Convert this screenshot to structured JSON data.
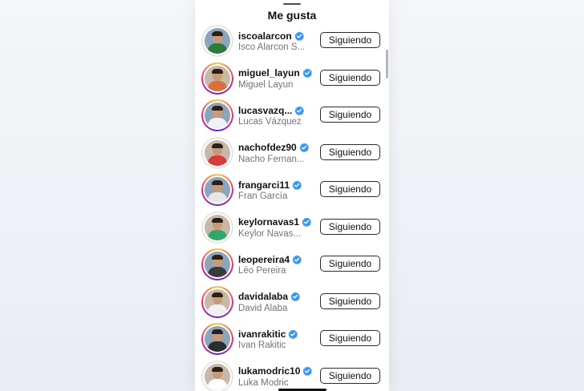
{
  "sheet": {
    "title": "Me gusta"
  },
  "colors": {
    "verified": "#3897f0",
    "story_ring": "#ee2a7b",
    "button_border": "#2a2a2a",
    "secondary_text": "#737373"
  },
  "users": [
    {
      "username": "iscoalarcon",
      "full_name": "Isco Alarcon S...",
      "button": "Siguiendo",
      "ring": false,
      "jersey": "#2f7a3a"
    },
    {
      "username": "miguel_layun",
      "full_name": "Miguel Layun",
      "button": "Siguiendo",
      "ring": true,
      "jersey": "#d9703a"
    },
    {
      "username": "lucasvazq...",
      "full_name": "Lucas Vázquez",
      "button": "Siguiendo",
      "ring": true,
      "jersey": "#f2f2f2"
    },
    {
      "username": "nachofdez90",
      "full_name": "Nacho Fernan...",
      "button": "Siguiendo",
      "ring": false,
      "jersey": "#d93a3a"
    },
    {
      "username": "frangarci11",
      "full_name": "Fran García",
      "button": "Siguiendo",
      "ring": true,
      "jersey": "#e8e8e8"
    },
    {
      "username": "keylornavas1",
      "full_name": "Keylor Navas...",
      "button": "Siguiendo",
      "ring": false,
      "jersey": "#2fa86a"
    },
    {
      "username": "leopereira4",
      "full_name": "Léo Pereira",
      "button": "Siguiendo",
      "ring": true,
      "jersey": "#3a3a3a"
    },
    {
      "username": "davidalaba",
      "full_name": "David Alaba",
      "button": "Siguiendo",
      "ring": true,
      "jersey": "#f0f0f0"
    },
    {
      "username": "ivanrakitic",
      "full_name": "Ivan Rakitic",
      "button": "Siguiendo",
      "ring": true,
      "jersey": "#2d2d2d"
    },
    {
      "username": "lukamodric10",
      "full_name": "Luka Modric",
      "button": "Siguiendo",
      "ring": false,
      "jersey": "#ffffff"
    }
  ]
}
